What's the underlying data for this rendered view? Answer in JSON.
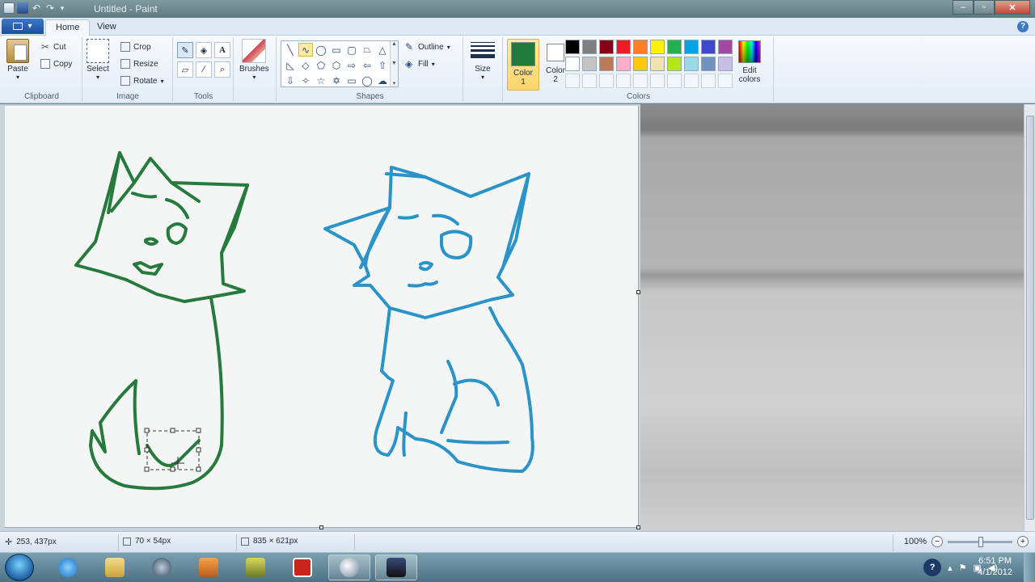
{
  "window": {
    "title": "Untitled - Paint"
  },
  "tabs": [
    {
      "label": "Home",
      "active": true
    },
    {
      "label": "View",
      "active": false
    }
  ],
  "clipboard": {
    "paste_label": "Paste",
    "cut_label": "Cut",
    "copy_label": "Copy",
    "group_label": "Clipboard"
  },
  "image": {
    "select_label": "Select",
    "crop_label": "Crop",
    "resize_label": "Resize",
    "rotate_label": "Rotate",
    "group_label": "Image"
  },
  "tools": {
    "group_label": "Tools",
    "items": [
      "pencil-icon",
      "fill-bucket-icon",
      "text-icon",
      "eraser-icon",
      "color-picker-icon",
      "magnifier-icon"
    ]
  },
  "brushes": {
    "label": "Brushes"
  },
  "shapes": {
    "group_label": "Shapes",
    "outline_label": "Outline",
    "fill_label": "Fill",
    "items": [
      "line",
      "curve",
      "oval",
      "rectangle",
      "rounded-rectangle",
      "polygon",
      "triangle",
      "right-triangle",
      "diamond",
      "pentagon",
      "hexagon",
      "right-arrow",
      "left-arrow",
      "up-arrow",
      "down-arrow",
      "four-point-star",
      "five-point-star",
      "six-point-star",
      "rounded-callout",
      "oval-callout",
      "cloud-callout"
    ],
    "active": "curve"
  },
  "size": {
    "label": "Size"
  },
  "colors": {
    "group_label": "Colors",
    "color1_label": "Color\n1",
    "color2_label": "Color\n2",
    "color1": "#217a3b",
    "color2": "#ffffff",
    "edit_label": "Edit\ncolors",
    "palette": [
      "#000000",
      "#7f7f7f",
      "#880015",
      "#ed1c24",
      "#ff7f27",
      "#fff200",
      "#22b14c",
      "#00a2e8",
      "#3f48cc",
      "#a349a4",
      "#ffffff",
      "#c3c3c3",
      "#b97a57",
      "#ffaec9",
      "#ffc90e",
      "#efe4b0",
      "#b5e61d",
      "#99d9ea",
      "#7092be",
      "#c8bfe7",
      "",
      "",
      "",
      "",
      "",
      "",
      "",
      "",
      "",
      ""
    ]
  },
  "drawing": {
    "green_stroke": "#257a3c",
    "blue_stroke": "#2a93c8"
  },
  "status": {
    "cursor_pos": "253, 437px",
    "selection_size": "70 × 54px",
    "image_size": "835 × 621px",
    "zoom": "100%"
  },
  "taskbar": {
    "time": "6:51 PM",
    "date": "4/1/2012",
    "apps": [
      "internet-explorer",
      "file-explorer",
      "media-center",
      "media-player",
      "game",
      "roblox",
      "paint",
      "app-window"
    ]
  }
}
